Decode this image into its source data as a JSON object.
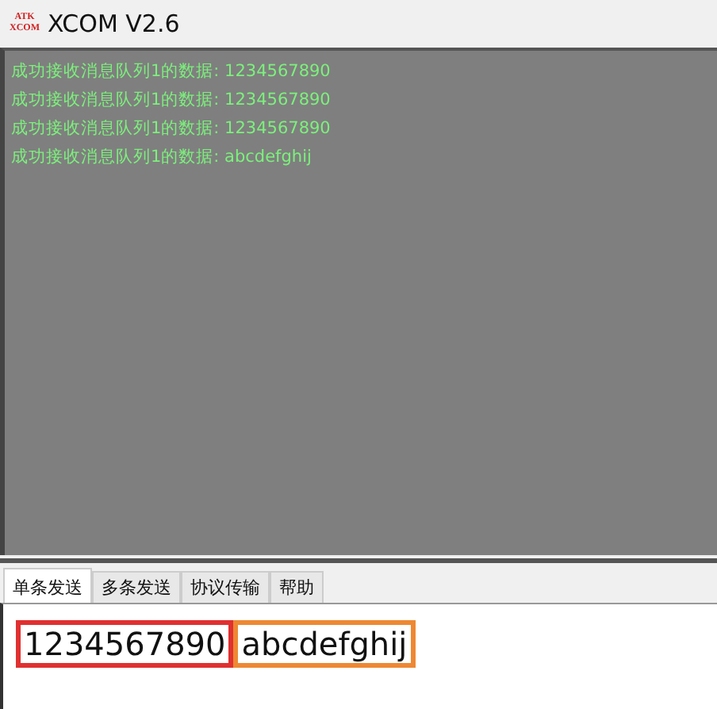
{
  "window": {
    "title": "XCOM V2.6",
    "logo_lines": [
      "ATK",
      "XCOM"
    ]
  },
  "log": [
    "成功接收消息队列1的数据: 1234567890",
    "成功接收消息队列1的数据: 1234567890",
    "成功接收消息队列1的数据: 1234567890",
    "成功接收消息队列1的数据: abcdefghij"
  ],
  "tabs": [
    {
      "label": "单条发送",
      "selected": true
    },
    {
      "label": "多条发送",
      "selected": false
    },
    {
      "label": "协议传输",
      "selected": false
    },
    {
      "label": "帮助",
      "selected": false
    }
  ],
  "send_field": {
    "segments": [
      {
        "text": "1234567890",
        "color": "#e03030"
      },
      {
        "text": "abcdefghij",
        "color": "#ee8833"
      }
    ]
  }
}
